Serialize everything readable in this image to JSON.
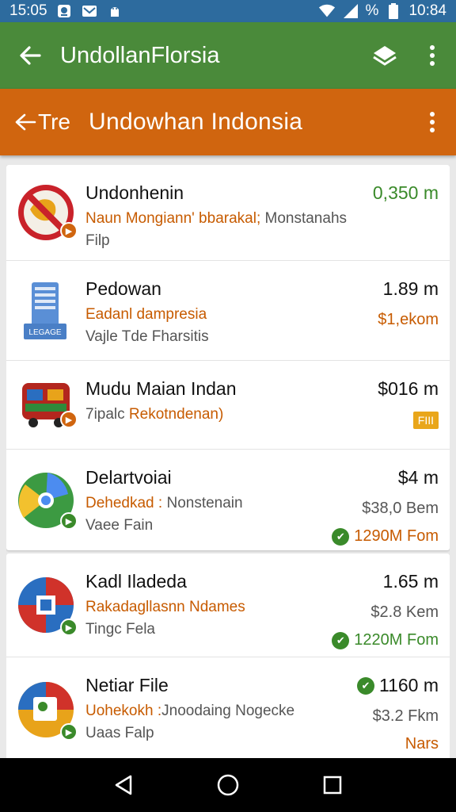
{
  "status_bar": {
    "left_time": "15:05",
    "battery_percent": "%",
    "time": "10:84"
  },
  "appbar": {
    "title": "UndollanFlorsia"
  },
  "subbar": {
    "back_label": "Tre",
    "title": "Undowhan  Indonsia"
  },
  "items": [
    {
      "name": "Undonhenin",
      "sub1_a": "Naun Mongiann' bbarakal;",
      "sub1_b": " Monstanahs",
      "sub2": "Filp",
      "size": "0,350 m"
    },
    {
      "name": "Pedowan",
      "sub1": "Eadanl dampresia",
      "sub2": "Vajle Tde Fharsitis",
      "size": "1.89 m",
      "price": "$1,ekom",
      "icon_label": "LEGAGE"
    },
    {
      "name": "Mudu Maian Indan",
      "sub1_a": "7ipalc ",
      "sub1_b": "Rekotndenan)",
      "size": "$016 m",
      "tag": "FIII"
    },
    {
      "name": "Delartvoiai",
      "sub1_a": "Dehedkad :",
      "sub1_b": " Nonstenain",
      "sub2": "Vaee Fain",
      "size": "$4 m",
      "price": "$38,0 Bem",
      "extra": "1290M Fom"
    },
    {
      "name": "Kadl Iladeda",
      "sub1": "Rakadagllasnn Ndames",
      "sub2": "Tingc Fela",
      "size": "1.65 m",
      "price": "$2.8 Kem",
      "extra": "1220M Fom"
    },
    {
      "name": "Netiar File",
      "sub1_a": "Uohekokh :",
      "sub1_b": "Jnoodaing Nogecke",
      "sub2": "Uaas Falp",
      "size": "1160 m",
      "price": "$3.2 Fkm",
      "extra": "Nars"
    }
  ],
  "colors": {
    "status_bar": "#2d6b9e",
    "appbar": "#4a8a3a",
    "subbar": "#d0650f",
    "accent_green": "#3a8a2a",
    "accent_orange": "#c75b00"
  }
}
